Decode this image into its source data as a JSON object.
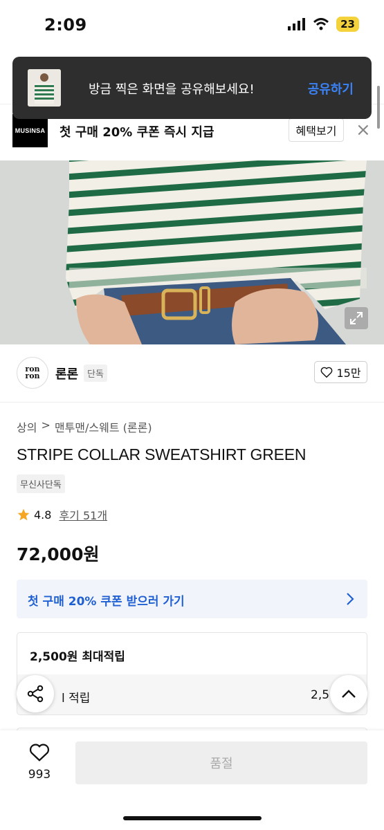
{
  "status": {
    "time": "2:09",
    "battery": "23"
  },
  "toast": {
    "message": "방금 찍은 화면을 공유해보세요!",
    "action": "공유하기"
  },
  "promo": {
    "logo_text": "MUSINSA",
    "text": "첫 구매 20% 쿠폰 즉시 지급",
    "button": "혜택보기",
    "close": "×"
  },
  "brand": {
    "logo_text": "ron ron",
    "name": "론론",
    "tag": "단독",
    "likes": "15만"
  },
  "product": {
    "breadcrumb": [
      "상의",
      ">",
      "맨투맨/스웨트 (론론)"
    ],
    "title": "STRIPE COLLAR SWEATSHIRT GREEN",
    "badge": "무신사단독",
    "rating": "4.8",
    "reviews": "후기 51개",
    "price": "72,000원"
  },
  "coupon": {
    "text": "첫 구매 20% 쿠폰 받으러 가기"
  },
  "points": {
    "max": "2,500원 최대적립",
    "sub_label": "l 적립",
    "sub_value": "2,5"
  },
  "bottom": {
    "wish_count": "993",
    "soldout": "품절"
  },
  "colors": {
    "accent_blue": "#1f5fd1",
    "stripe_green": "#1f6b45",
    "toast_bg": "#2e2e2e"
  },
  "icons": [
    "signal-icon",
    "wifi-icon",
    "heart-icon",
    "star-icon",
    "chevron-right-icon",
    "share-icon",
    "chevron-up-icon",
    "expand-icon",
    "close-icon"
  ]
}
